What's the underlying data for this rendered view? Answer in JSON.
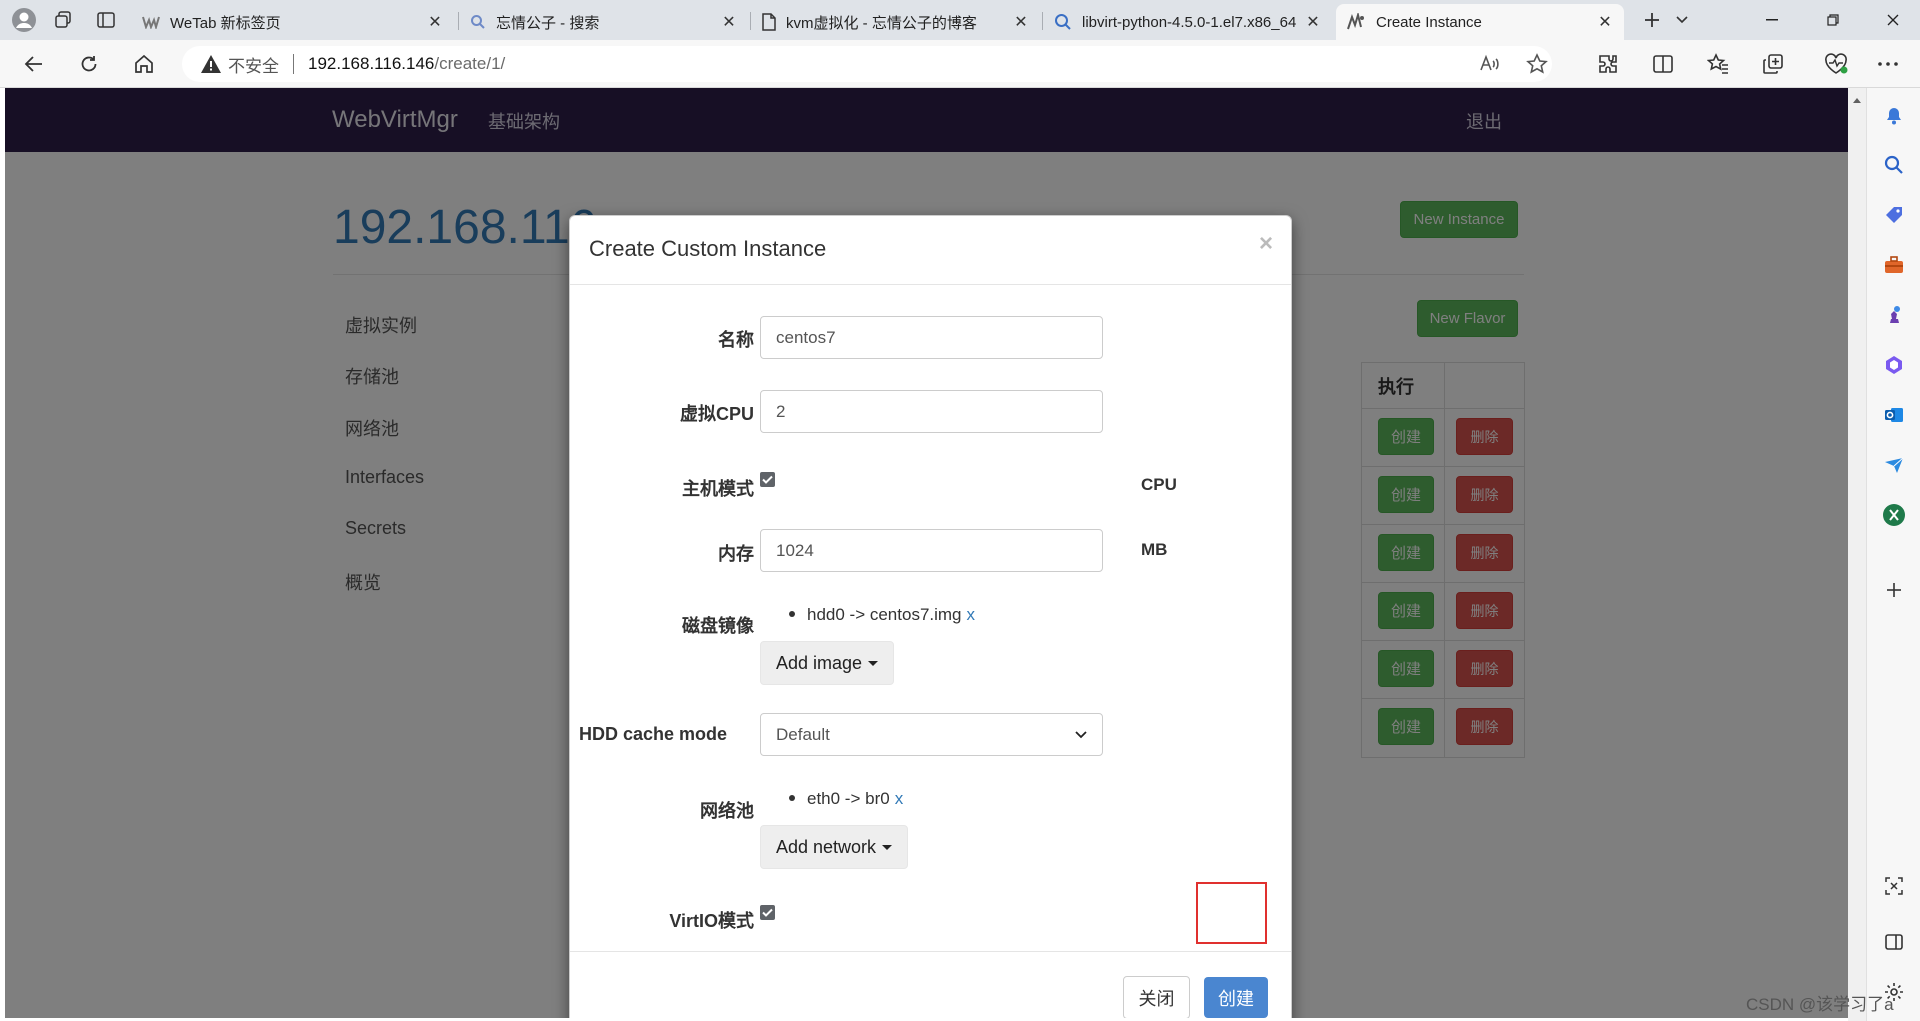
{
  "browser": {
    "tabs": [
      {
        "title": "WeTab 新标签页",
        "icon": "wetab-icon",
        "active": false
      },
      {
        "title": "忘情公子 - 搜索",
        "icon": "search-icon",
        "active": false
      },
      {
        "title": "kvm虚拟化 - 忘情公子的博客",
        "icon": "document-icon",
        "active": false
      },
      {
        "title": "libvirt-python-4.5.0-1.el7.x86_64",
        "icon": "search-icon",
        "active": false
      },
      {
        "title": "Create Instance",
        "icon": "webvirtmgr-icon",
        "active": true
      }
    ],
    "address": {
      "security_label": "不安全",
      "host": "192.168.116.146",
      "path": "/create/1/"
    }
  },
  "app": {
    "brand": "WebVirtMgr",
    "nav_infrastructure": "基础架构",
    "nav_logout": "退出",
    "host_title": "192.168.116",
    "new_instance": "New Instance",
    "new_flavor": "New Flavor",
    "sidebar": [
      "虚拟实例",
      "存储池",
      "网络池",
      "Interfaces",
      "Secrets",
      "概览"
    ],
    "table_header_action": "执行",
    "row_create": "创建",
    "row_delete": "删除"
  },
  "modal": {
    "title": "Create Custom Instance",
    "close_glyph": "×",
    "fields": {
      "name_label": "名称",
      "name_value": "centos7",
      "vcpu_label": "虚拟CPU",
      "vcpu_value": "2",
      "hostmode_label": "主机模式",
      "hostmode_unit": "CPU",
      "hostmode_checked": true,
      "memory_label": "内存",
      "memory_value": "1024",
      "memory_unit": "MB",
      "disk_label": "磁盘镜像",
      "disk_item": "hdd0 -> centos7.img",
      "disk_remove": "x",
      "add_image": "Add image",
      "cache_label": "HDD cache mode",
      "cache_value": "Default",
      "network_label": "网络池",
      "network_item": "eth0 -> br0",
      "network_remove": "x",
      "add_network": "Add network",
      "virtio_label": "VirtIO模式",
      "virtio_checked": true
    },
    "close_button": "关闭",
    "create_button": "创建"
  },
  "watermark": "CSDN @该学习了a",
  "colors": {
    "navbar": "#2f1f4a",
    "primary": "#4a86d0",
    "success": "#5cb85c",
    "danger": "#d9534f",
    "highlight": "#e0302e"
  }
}
